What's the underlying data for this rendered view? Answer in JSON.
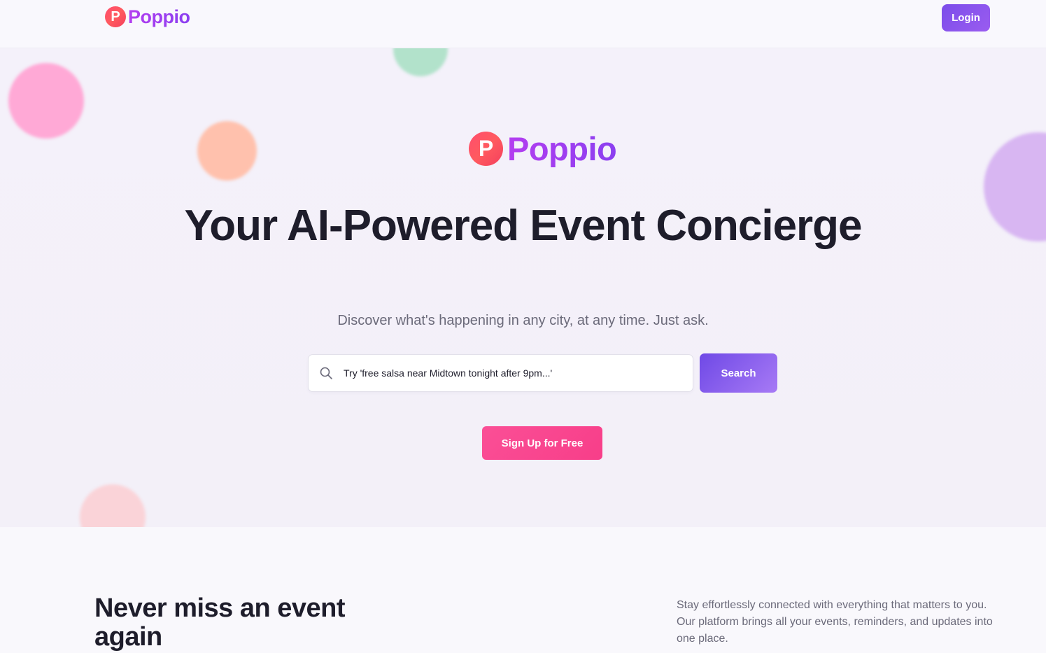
{
  "brand": {
    "badge_letter": "P",
    "name": "Poppio",
    "colors": {
      "badge": "#ff5a5f",
      "wordmark": "#9b3ff0",
      "primary": "#7c4dea",
      "cta": "#fa4f96"
    }
  },
  "header": {
    "login_label": "Login"
  },
  "hero": {
    "title": "Your AI-Powered Event Concierge",
    "subtitle": "Discover what's happening in any city, at any time. Just ask.",
    "search": {
      "icon": "search-icon",
      "placeholder": "Try 'free salsa near Midtown tonight after 9pm...'",
      "value": "",
      "button_label": "Search"
    },
    "signup_label": "Sign Up for Free"
  },
  "features": {
    "heading": "Never miss an event again",
    "description": "Stay effortlessly connected with everything that matters to you. Our platform brings all your events, reminders, and updates into one place."
  }
}
